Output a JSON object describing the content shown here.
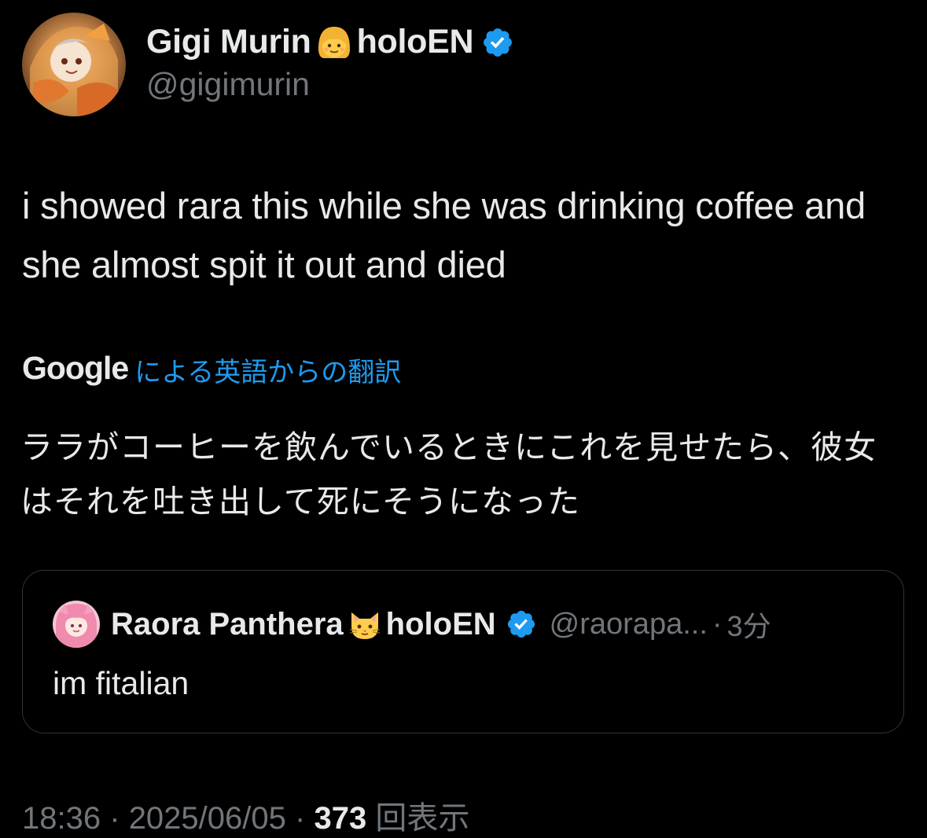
{
  "author": {
    "name": "Gigi Murin",
    "org": "holoEN",
    "handle": "@gigimurin"
  },
  "tweet": {
    "text": "i showed rara this while she was drinking coffee and she almost spit it out and died"
  },
  "translation": {
    "provider": "Google",
    "label": "による英語からの翻訳",
    "text": "ララがコーヒーを飲んでいるときにこれを見せたら、彼女はそれを吐き出して死にそうになった"
  },
  "quoted": {
    "name": "Raora Panthera",
    "org": "holoEN",
    "handle": "@raorapa...",
    "separator": "·",
    "time": "3分",
    "text": "im fitalian"
  },
  "meta": {
    "time": "18:36",
    "sep1": "·",
    "date": "2025/06/05",
    "sep2": "·",
    "views": "373",
    "views_label": "回表示"
  },
  "colors": {
    "background": "#000000",
    "text": "#e7e9ea",
    "secondary": "#71767b",
    "link": "#1d9bf0",
    "verified": "#1d9bf0",
    "border": "#2f3336"
  }
}
